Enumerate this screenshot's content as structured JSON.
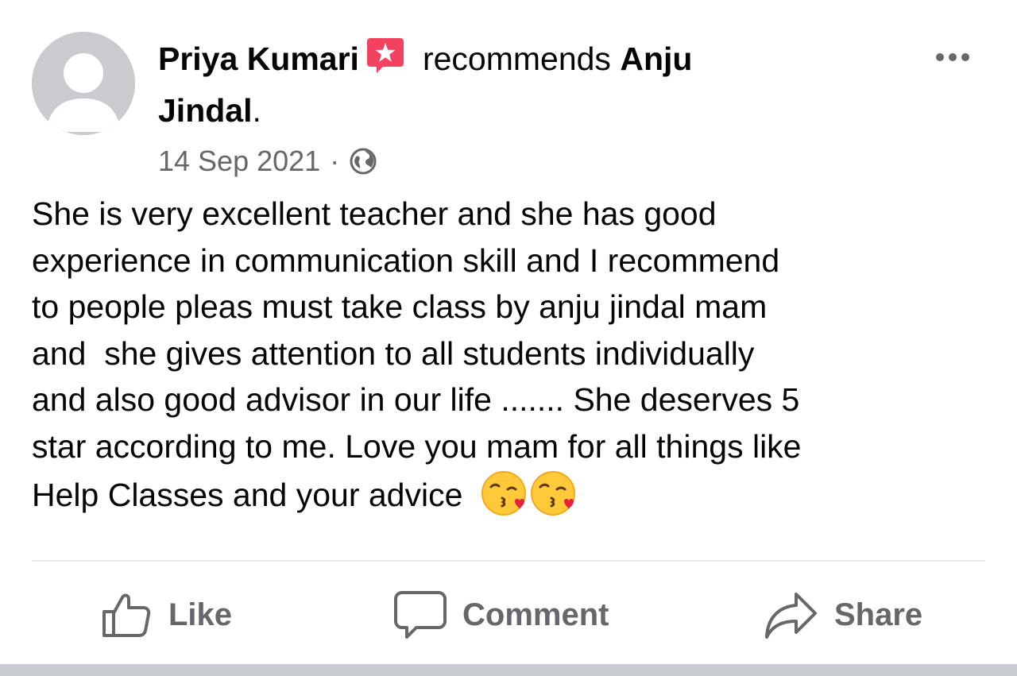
{
  "post": {
    "author": "Priya Kumari",
    "verb": "recommends",
    "target_first": "Anju",
    "target_second": "Jindal",
    "target_suffix": ".",
    "date": "14 Sep 2021",
    "separator": "·",
    "privacy_icon": "globe-icon",
    "badge_icon": "recommendation-star-icon",
    "body": "She is very excellent teacher and she has good\nexperience in communication skill and I recommend\nto people pleas must take class by anju jindal mam\nand  she gives attention to all students individually\nand also good advisor in our life ....... She deserves 5\nstar according to me. Love you mam for all things like\nHelp Classes and your advice",
    "emojis": [
      "face-blowing-kiss-emoji",
      "face-blowing-kiss-emoji"
    ]
  },
  "actions": {
    "like_label": "Like",
    "comment_label": "Comment",
    "share_label": "Share"
  },
  "colors": {
    "text": "#050505",
    "secondary": "#65676b",
    "badge": "#f3425f",
    "divider": "#e4e6eb",
    "avatar_bg": "#c9cbcf"
  }
}
